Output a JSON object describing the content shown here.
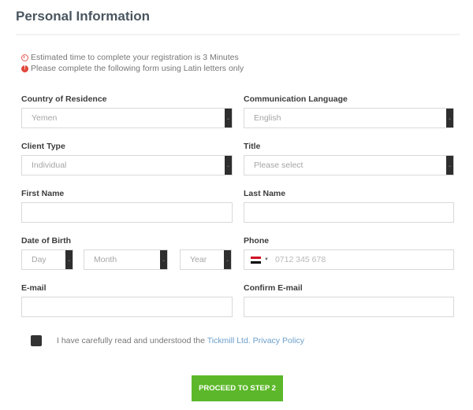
{
  "header": {
    "title": "Personal Information"
  },
  "notices": [
    {
      "icon": "clock-icon",
      "text": "Estimated time to complete your registration is 3 Minutes"
    },
    {
      "icon": "alert-icon",
      "text": "Please complete the following form using Latin letters only"
    }
  ],
  "form": {
    "country": {
      "label": "Country of Residence",
      "value": "Yemen"
    },
    "language": {
      "label": "Communication Language",
      "value": "English"
    },
    "client_type": {
      "label": "Client Type",
      "value": "Individual"
    },
    "title": {
      "label": "Title",
      "value": "Please select"
    },
    "first_name": {
      "label": "First Name",
      "value": ""
    },
    "last_name": {
      "label": "Last Name",
      "value": ""
    },
    "dob": {
      "label": "Date of Birth",
      "day": "Day",
      "month": "Month",
      "year": "Year"
    },
    "phone": {
      "label": "Phone",
      "placeholder": "0712 345 678",
      "flag": "yemen-flag-icon"
    },
    "email": {
      "label": "E-mail",
      "value": ""
    },
    "confirm_email": {
      "label": "Confirm E-mail",
      "value": ""
    }
  },
  "consent": {
    "text": "I have carefully read and understood the ",
    "link": "Tickmill Ltd. Privacy Policy"
  },
  "actions": {
    "proceed": "PROCEED TO STEP 2"
  },
  "colors": {
    "accent": "#5cb82a",
    "link": "#6a9ecb",
    "alert": "#e0463a",
    "flag_red": "#ce1126",
    "flag_white": "#ffffff",
    "flag_black": "#000000"
  }
}
